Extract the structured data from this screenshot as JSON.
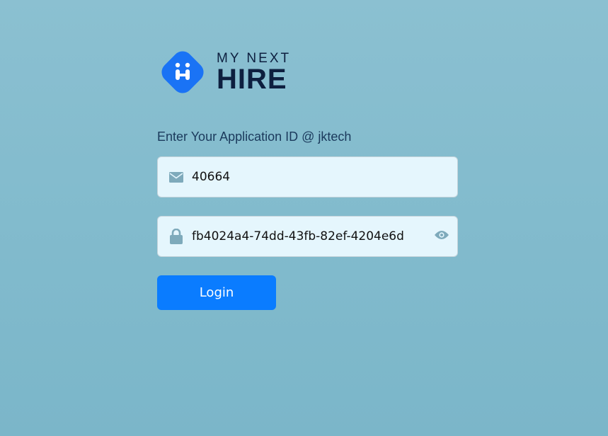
{
  "brand": {
    "line1": "MY NEXT",
    "line2": "HIRE"
  },
  "form": {
    "label": "Enter Your Application ID @ jktech",
    "application_id": "40664",
    "password": "fb4024a4-74dd-43fb-82ef-4204e6d",
    "login_label": "Login"
  },
  "colors": {
    "accent": "#0a7cff",
    "brand": "#1a73f5",
    "text": "#0d1f3f"
  }
}
